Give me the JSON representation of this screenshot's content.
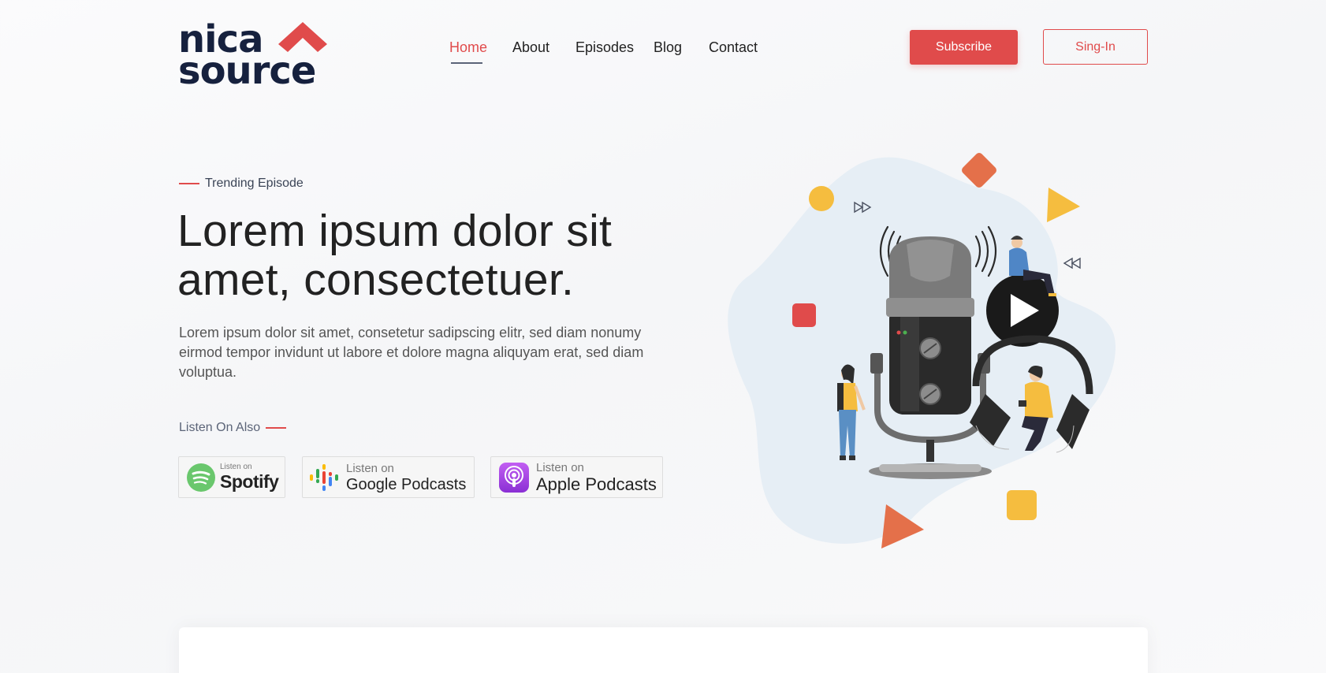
{
  "brand": {
    "line1": "nica",
    "line2": "source",
    "navy": "#16213e",
    "red": "#e04b4b"
  },
  "nav": {
    "items": [
      {
        "label": "Home",
        "active": true
      },
      {
        "label": "About"
      },
      {
        "label": "Episodes"
      },
      {
        "label": "Blog"
      },
      {
        "label": "Contact"
      }
    ]
  },
  "header": {
    "subscribe_label": "Subscribe",
    "signin_label": "Sing-In"
  },
  "hero": {
    "kicker": "Trending Episode",
    "headline_line1": "Lorem ipsum dolor sit",
    "headline_line2": "amet, consectetuer.",
    "lead": "Lorem ipsum dolor sit amet, consetetur sadipscing elitr, sed diam nonumy eirmod tempor invidunt ut labore et dolore magna aliquyam erat, sed diam voluptua.",
    "listen_also": "Listen On Also"
  },
  "badges": {
    "spotify": {
      "small": "Listen on",
      "big": "Spotify",
      "icon": "spotify-icon"
    },
    "google": {
      "small": "Listen on",
      "big": "Google Podcasts",
      "icon": "google-podcasts-icon"
    },
    "apple": {
      "small": "Listen on",
      "big": "Apple Podcasts",
      "icon": "apple-podcasts-icon"
    }
  },
  "colors": {
    "accent": "#e04b4b",
    "orange": "#e4704a",
    "yellow": "#f5bd3f",
    "blob": "#e6eef5"
  }
}
